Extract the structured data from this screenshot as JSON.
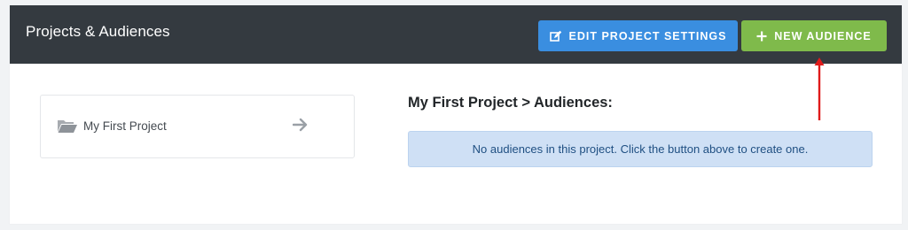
{
  "header": {
    "title": "Projects & Audiences"
  },
  "toolbar": {
    "edit_settings_label": "EDIT PROJECT SETTINGS",
    "new_audience_label": "NEW AUDIENCE"
  },
  "projects": [
    {
      "name": "My First Project"
    }
  ],
  "audiences": {
    "heading": "My First Project > Audiences:",
    "empty_message": "No audiences in this project. Click the button above to create one."
  },
  "icons": {
    "edit": "edit-icon",
    "plus": "plus-icon",
    "folder": "folder-open-icon",
    "arrow": "arrow-right-icon"
  },
  "colors": {
    "header_bg": "#343a40",
    "edit_button": "#3a8ee0",
    "new_button": "#7fba4b",
    "alert_bg": "#cfe0f5",
    "alert_text": "#1f4f82",
    "annotation_arrow": "#e01b1b"
  }
}
